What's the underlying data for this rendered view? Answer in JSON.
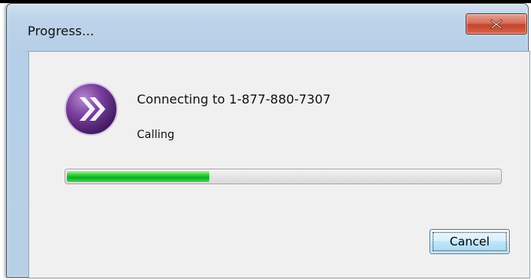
{
  "window": {
    "title": "Progress...",
    "close_icon": "close-x-icon"
  },
  "dialog": {
    "logo_icon": "purple-double-chevron-logo",
    "status_text": "Connecting to 1-877-880-7307",
    "sub_status_text": "Calling",
    "progress": {
      "value_percent": 33,
      "color": "#06b025"
    },
    "cancel_label": "Cancel"
  },
  "colors": {
    "close_button": "#c2442b",
    "logo_purple": "#5a2a7a",
    "progress_green": "#06b025"
  }
}
